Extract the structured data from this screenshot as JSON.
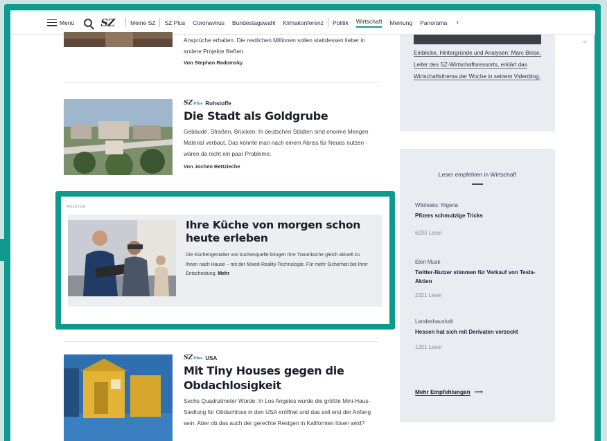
{
  "nav": {
    "menu_label": "Menü",
    "logo": "SZ",
    "links": [
      "Meine SZ",
      "SZ Plus",
      "Coronavirus",
      "Bundestagswahl",
      "Klimakonferenz",
      "Politik",
      "Wirtschaft",
      "Meinung",
      "Panorama"
    ],
    "active": "Wirtschaft",
    "more_glyph": "›"
  },
  "articles": [
    {
      "teaser": "Ansprüche erhalten. Die restlichen Millionen sollen stattdessen lieber in andere Projekte fließen.",
      "author": "Von Stephan Radomsky"
    },
    {
      "kicker": "Rohstoffe",
      "plus_tag": "SZ",
      "plus_small": "Plus",
      "headline": "Die Stadt als Goldgrube",
      "teaser": "Gebäude, Straßen, Brücken: In deutschen Städten sind enorme Mengen Material verbaut. Das könnte man nach einem Abriss für Neues nutzen - wären da nicht ein paar Probleme.",
      "author": "Von Jochen Bettzieche"
    },
    {
      "kicker": "USA",
      "plus_tag": "SZ",
      "plus_small": "Plus",
      "headline": "Mit Tiny Houses gegen die Obdachlosigkeit",
      "teaser": "Sechs Quadratmeter Würde: In Los Angeles wurde die größte Mini-Haus-Siedlung für Obdachlose in den USA eröffnet und das soll erst der Anfang sein. Aber ob das auch der gerechte Restgen in Kalifornien lösen wird?"
    }
  ],
  "ad": {
    "label": "ANZEIGE",
    "headline": "Ihre Küche von morgen schon heute erleben",
    "teaser": "Die Küchengestalter von küchenquelle bringen Ihre Traumküche gleich aktuell zu Ihnen nach Hause – mit der Mixed-Reality-Technologie. Für mehr Sicherheit bei Ihrer Entscheidung.",
    "more": "Mehr"
  },
  "sidebar": {
    "intro_text": "Einblicke, Hintergründe und Analysen: Marc Beise, Leiter des SZ-Wirtschaftsressorts, erklärt das Wirtschaftsthema der Woche in seinem Videoblog.",
    "rec_title": "Leser empfehlen in Wirtschaft",
    "recommendations": [
      {
        "kicker": "Wikileaks: Nigeria",
        "headline": "Pfizers schmutzige Tricks",
        "count": "6293 Leser"
      },
      {
        "kicker": "Elon Musk",
        "headline": "Twitter-Nutzer stimmen für Verkauf von Tesla-Aktien",
        "count": "2321 Leser"
      },
      {
        "kicker": "Landeshaushalt",
        "headline": "Hessen hat sich mit Derivaten verzockt",
        "count": "1201 Leser"
      }
    ],
    "more_label": "Mehr Empfehlungen",
    "more_arrow": "⟶"
  },
  "edge_text": "nä",
  "colors": {
    "accent": "#0f9a90",
    "sidebar_bg": "#e9edf2",
    "ad_bg": "#eceef1"
  }
}
